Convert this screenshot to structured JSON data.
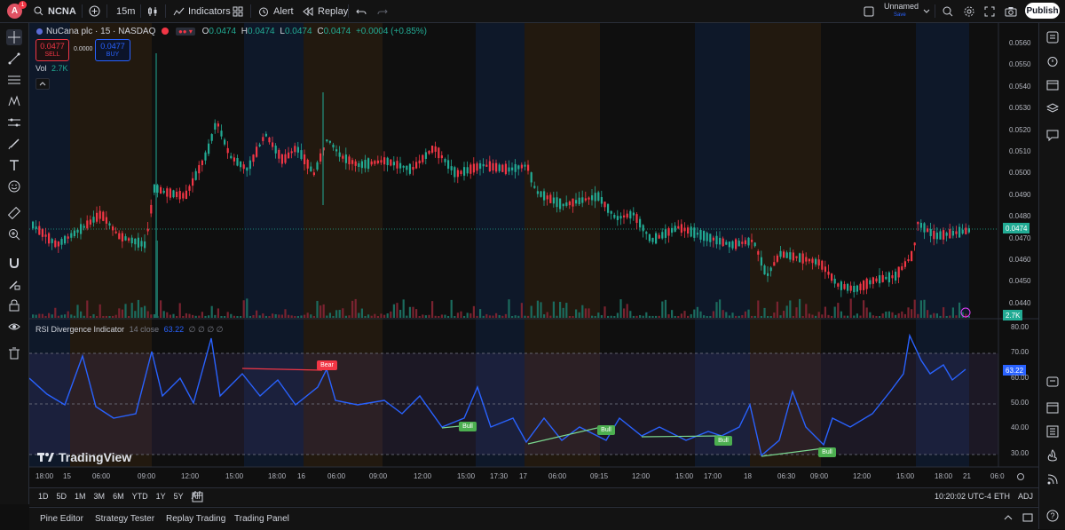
{
  "header": {
    "avatar_letter": "A",
    "notification_count": "1",
    "symbol": "NCNA",
    "interval": "15m",
    "indicators_label": "Indicators",
    "alert_label": "Alert",
    "replay_label": "Replay",
    "layout_name": "Unnamed",
    "layout_status": "Save",
    "publish_label": "Publish"
  },
  "legend": {
    "title": "NuCana plc · 15 · NASDAQ",
    "o_key": "O",
    "o_val": "0.0474",
    "h_key": "H",
    "h_val": "0.0474",
    "l_key": "L",
    "l_val": "0.0474",
    "c_key": "C",
    "c_val": "0.0474",
    "change": "+0.0004 (+0.85%)",
    "sell_price": "0.0477",
    "sell_label": "SELL",
    "spread": "0.0000",
    "buy_price": "0.0477",
    "buy_label": "BUY",
    "vol_label": "Vol",
    "vol_value": "2.7K"
  },
  "price_axis": {
    "ticks": [
      "0.0560",
      "0.0550",
      "0.0540",
      "0.0530",
      "0.0520",
      "0.0510",
      "0.0500",
      "0.0490",
      "0.0480",
      "0.0470",
      "0.0460",
      "0.0450",
      "0.0440"
    ],
    "current": "0.0474",
    "vol_current": "2.7K"
  },
  "rsi": {
    "title": "RSI Divergence Indicator",
    "params": "14 close",
    "value": "63.22",
    "placeholders": "∅ ∅ ∅ ∅",
    "ticks": [
      "80.00",
      "70.00",
      "60.00",
      "50.00",
      "40.00",
      "30.00"
    ],
    "current": "63.22",
    "bear_label": "Bear",
    "bull_label": "Bull"
  },
  "time_axis": [
    "18:00",
    "15",
    "06:00",
    "09:00",
    "12:00",
    "15:00",
    "18:00",
    "16",
    "06:00",
    "09:00",
    "12:00",
    "15:00",
    "17:30",
    "17",
    "06:00",
    "09:15",
    "12:00",
    "15:00",
    "17:00",
    "18",
    "06:30",
    "09:00",
    "12:00",
    "15:00",
    "18:00",
    "21",
    "06:0"
  ],
  "watermark": "TradingView",
  "ranges": [
    "1D",
    "5D",
    "1M",
    "3M",
    "6M",
    "YTD",
    "1Y",
    "5Y",
    "All"
  ],
  "clock": "10:20:02 UTC-4",
  "session": "ETH",
  "adjust": "ADJ",
  "footer_tabs": [
    "Pine Editor",
    "Strategy Tester",
    "Replay Trading",
    "Trading Panel"
  ],
  "colors": {
    "up": "#22ab94",
    "down": "#f23645",
    "rsi": "#2962ff",
    "bg": "#0f0f0f",
    "accent": "#2962ff"
  },
  "icons": {
    "left": [
      "crosshair-icon",
      "trend-line-icon",
      "fib-icon",
      "pattern-icon",
      "forecast-icon",
      "brush-icon",
      "text-icon",
      "emoji-icon",
      "ruler-icon",
      "zoom-icon",
      "magnet-icon",
      "lock-draw-icon",
      "lock-icon",
      "eye-icon",
      "trash-icon"
    ],
    "right": [
      "watchlist-icon",
      "alerts-icon",
      "data-window-icon",
      "layers-icon",
      "chat-icon",
      "ideas-icon",
      "calendar-icon",
      "news-icon",
      "hotlist-icon",
      "broadcast-icon",
      "help-icon"
    ]
  }
}
